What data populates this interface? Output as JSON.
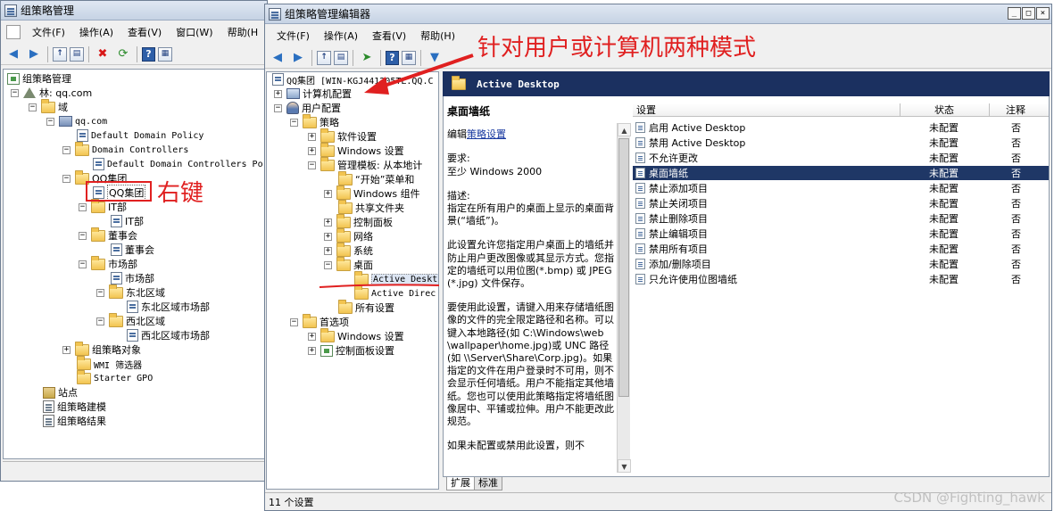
{
  "left_window": {
    "title": "组策略管理",
    "menu": [
      "文件(F)",
      "操作(A)",
      "查看(V)",
      "窗口(W)",
      "帮助(H"
    ],
    "tree": {
      "root": "组策略管理",
      "forest": "林: qq.com",
      "domains": "域",
      "domain": "qq.com",
      "default_domain_policy": "Default Domain Policy",
      "domain_controllers": "Domain Controllers",
      "default_dc_policy": "Default Domain Controllers Po",
      "ou_qq": "QQ集团",
      "gpo_qq": "QQ集团",
      "it_ou": "IT部",
      "it_gpo": "IT部",
      "board_ou": "董事会",
      "board_gpo": "董事会",
      "market_ou": "市场部",
      "market_gpo": "市场部",
      "ne_ou": "东北区域",
      "ne_gpo": "东北区域市场部",
      "nw_ou": "西北区域",
      "nw_gpo": "西北区域市场部",
      "gpo_objects": "组策略对象",
      "wmi_filters": "WMI 筛选器",
      "starter_gpo": "Starter GPO",
      "sites": "站点",
      "modeling": "组策略建模",
      "results": "组策略结果"
    }
  },
  "right_window": {
    "title": "组策略管理编辑器",
    "menu": [
      "文件(F)",
      "操作(A)",
      "查看(V)",
      "帮助(H)"
    ],
    "tree": {
      "root": "QQ集团 [WIN-KGJ441205TL.QQ.C",
      "computer_config": "计算机配置",
      "user_config": "用户配置",
      "policies": "策略",
      "software": "软件设置",
      "windows_settings": "Windows 设置",
      "admin_templates": "管理模板: 从本地计",
      "start_menu": "“开始”菜单和",
      "windows_components": "Windows 组件",
      "shared_folders": "共享文件夹",
      "control_panel": "控制面板",
      "network": "网络",
      "system": "系统",
      "desktop": "桌面",
      "active_desktop": "Active Deskt",
      "active_directory": "Active Direc",
      "all_settings": "所有设置",
      "preferences": "首选项",
      "pref_windows_settings": "Windows 设置",
      "pref_control_panel": "控制面板设置"
    },
    "header": "Active Desktop",
    "description": {
      "title": "桌面墙纸",
      "edit_prefix": "编辑",
      "edit_link": "策略设置",
      "req_label": "要求:",
      "req_value": "至少 Windows 2000",
      "desc_label": "描述:",
      "desc_1": "指定在所有用户的桌面上显示的桌面背景(“墙纸”)。",
      "desc_2": "此设置允许您指定用户桌面上的墙纸并防止用户更改图像或其显示方式。您指定的墙纸可以用位图(*.bmp) 或 JPEG (*.jpg) 文件保存。",
      "desc_3": "要使用此设置，请键入用来存储墙纸图像的文件的完全限定路径和名称。可以键入本地路径(如 C:\\Windows\\web\\wallpaper\\home.jpg)或 UNC 路径(如 \\\\Server\\Share\\Corp.jpg)。如果指定的文件在用户登录时不可用，则不会显示任何墙纸。用户不能指定其他墙纸。您也可以使用此策略指定将墙纸图像居中、平铺或拉伸。用户不能更改此规范。",
      "desc_4": "如果未配置或禁用此设置，则不"
    },
    "columns": [
      "设置",
      "状态",
      "注释"
    ],
    "rows": [
      {
        "name": "启用 Active Desktop",
        "state": "未配置",
        "note": "否"
      },
      {
        "name": "禁用 Active Desktop",
        "state": "未配置",
        "note": "否"
      },
      {
        "name": "不允许更改",
        "state": "未配置",
        "note": "否"
      },
      {
        "name": "桌面墙纸",
        "state": "未配置",
        "note": "否"
      },
      {
        "name": "禁止添加项目",
        "state": "未配置",
        "note": "否"
      },
      {
        "name": "禁止关闭项目",
        "state": "未配置",
        "note": "否"
      },
      {
        "name": "禁止删除项目",
        "state": "未配置",
        "note": "否"
      },
      {
        "name": "禁止编辑项目",
        "state": "未配置",
        "note": "否"
      },
      {
        "name": "禁用所有项目",
        "state": "未配置",
        "note": "否"
      },
      {
        "name": "添加/删除项目",
        "state": "未配置",
        "note": "否"
      },
      {
        "name": "只允许使用位图墙纸",
        "state": "未配置",
        "note": "否"
      }
    ],
    "tabs": [
      "扩展",
      "标准"
    ],
    "status": "11 个设置"
  },
  "annotations": {
    "right_click": "右键",
    "two_modes": "针对用户或计算机两种模式"
  },
  "watermark": "CSDN @Fighting_hawk",
  "colors": {
    "selection": "#1f3766",
    "annotation": "#e02020",
    "header_bar": "#1b3060"
  }
}
